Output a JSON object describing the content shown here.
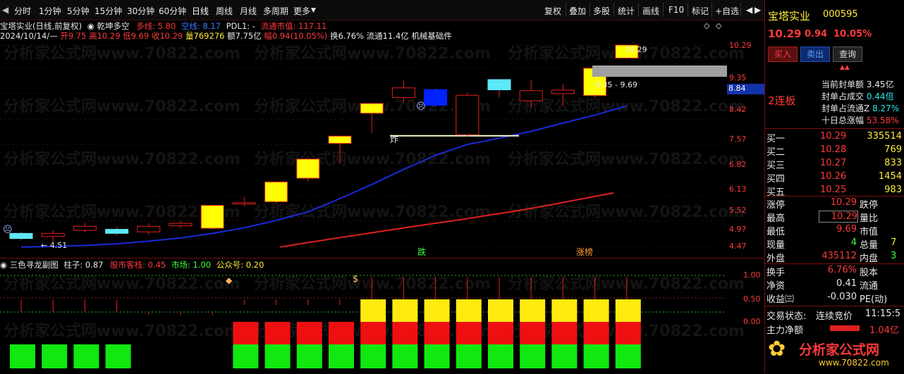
{
  "toolbar": {
    "left_items": [
      "分时",
      "1分钟",
      "5分钟",
      "15分钟",
      "30分钟",
      "60分钟",
      "日线",
      "周线",
      "月线",
      "多周期",
      "更多"
    ],
    "right_items": [
      "复权",
      "叠加",
      "多股",
      "统计",
      "画线",
      "F10",
      "标记",
      "+自选"
    ],
    "back_symbol": "◀"
  },
  "main_chart": {
    "title_line": {
      "name": "宝塔实业(日线,前复权)",
      "indicator_name": "乾坤多空",
      "duo_label": "多线: 5.80",
      "kong_label": "空线: 8.17",
      "pdl_label": "PDL1: -",
      "float_label": "流通市值: 117.11"
    },
    "quote_line": {
      "date": "2024/10/14/—",
      "open": "开9.75",
      "high": "高10.29",
      "low": "低9.69",
      "close": "收10.29",
      "volume": "量769276",
      "amount": "额7.75亿",
      "change": "幅0.94(10.05%)",
      "turnover": "换6.76%",
      "float_shares": "流通11.4亿",
      "sector": "机械基础件"
    },
    "price_labels": [
      "10.29",
      "9.35",
      "8.42",
      "7.57",
      "6.82",
      "6.13",
      "5.52",
      "4.97",
      "4.47"
    ],
    "current_tag": "8.84",
    "range_label": "9.35 - 9.69",
    "high_label": "10.29",
    "low_label": "← 4.51",
    "text_marks": {
      "zha": "炸",
      "die": "跌",
      "zhangting": "涨榜"
    },
    "watermark": "分析家公式网www.70822.com"
  },
  "sub_chart": {
    "name": "三色寻龙副图",
    "zhuzi": "柱子: 0.87",
    "guzhu": "股市客栈: 0.45",
    "shichang": "市场: 1.00",
    "gongzhonghao": "公众号: 0.20",
    "scale": [
      "1.00",
      "0.50",
      "0.00"
    ]
  },
  "chart_data": {
    "type": "candlestick",
    "candles": [
      {
        "open": 4.62,
        "close": 4.72,
        "high": 4.76,
        "low": 4.58,
        "color": "#5ee8f8"
      },
      {
        "open": 4.72,
        "close": 4.66,
        "high": 4.78,
        "low": 4.55,
        "color": "#000000"
      },
      {
        "open": 4.78,
        "close": 4.86,
        "high": 4.93,
        "low": 4.74,
        "color": "#000000"
      },
      {
        "open": 4.8,
        "close": 4.72,
        "high": 4.85,
        "low": 4.68,
        "color": "#5ee8f8"
      },
      {
        "open": 4.75,
        "close": 4.86,
        "high": 4.92,
        "low": 4.69,
        "color": "#000000"
      },
      {
        "open": 4.87,
        "close": 4.92,
        "high": 4.97,
        "low": 4.82,
        "color": "#000000"
      },
      {
        "open": 4.82,
        "close": 5.3,
        "high": 5.3,
        "low": 4.8,
        "color": "#ffff00"
      },
      {
        "open": 5.33,
        "close": 5.36,
        "high": 5.48,
        "low": 5.28,
        "color": "#000000"
      },
      {
        "open": 5.38,
        "close": 5.84,
        "high": 5.84,
        "low": 5.33,
        "color": "#ffff00"
      },
      {
        "open": 5.93,
        "close": 6.42,
        "high": 6.42,
        "low": 5.85,
        "color": "#ffff00"
      },
      {
        "open": 6.85,
        "close": 7.06,
        "high": 7.06,
        "low": 6.3,
        "color": "#ffff00"
      },
      {
        "open": 7.76,
        "close": 8.08,
        "high": 8.08,
        "low": 7.15,
        "color": "#ffff00"
      },
      {
        "open": 8.28,
        "close": 8.62,
        "high": 8.9,
        "low": 8.12,
        "color": "#000000"
      },
      {
        "open": 8.56,
        "close": 8.02,
        "high": 8.6,
        "low": 7.97,
        "color": "#0022ff"
      },
      {
        "open": 8.36,
        "close": 7.1,
        "high": 8.45,
        "low": 7.04,
        "color": "#000000"
      },
      {
        "open": 8.55,
        "close": 8.92,
        "high": 8.92,
        "low": 8.28,
        "color": "#5ee8f8"
      },
      {
        "open": 8.17,
        "close": 8.52,
        "high": 8.92,
        "low": 7.93,
        "color": "#000000"
      },
      {
        "open": 8.42,
        "close": 8.54,
        "high": 8.75,
        "low": 8.0,
        "color": "#000000"
      },
      {
        "open": 8.35,
        "close": 9.35,
        "high": 9.35,
        "low": 8.28,
        "color": "#ffff00"
      },
      {
        "open": 9.75,
        "close": 10.29,
        "high": 10.29,
        "low": 9.69,
        "color": "#ffff00"
      }
    ],
    "blue_line": [
      4.46,
      4.47,
      4.49,
      4.52,
      4.57,
      4.63,
      4.72,
      4.83,
      4.98,
      5.16,
      5.45,
      5.78,
      6.15,
      6.52,
      6.82,
      7.0,
      7.2,
      7.45,
      7.7,
      8.0
    ],
    "red_line": [
      4.46,
      4.55,
      4.64,
      4.73,
      4.82,
      4.91,
      5.0,
      5.1,
      5.2,
      5.32,
      5.45,
      5.58
    ],
    "sub_bars": {
      "green": [
        1,
        1,
        1,
        1,
        0,
        0,
        0,
        0,
        0,
        0,
        0,
        0,
        0,
        0,
        0,
        0,
        0,
        0,
        0,
        0
      ],
      "red": [
        0,
        0,
        0,
        0,
        0,
        0,
        0,
        1,
        1,
        1,
        1,
        1,
        1,
        1,
        1,
        1,
        1,
        1,
        1,
        1
      ],
      "yellow": [
        0,
        0,
        0,
        0,
        0,
        0,
        0,
        0,
        0,
        0,
        0,
        1,
        1,
        1,
        1,
        1,
        1,
        1,
        1,
        1
      ]
    }
  },
  "panel": {
    "stock_name": "宝塔实业",
    "stock_code": "000595",
    "price": "10.29",
    "change": "0.94",
    "change_pct": "10.05%",
    "buttons": [
      "买入",
      "卖出",
      "查询"
    ],
    "banner": "2连板",
    "seal": {
      "amount_label": "当前封单额",
      "amount_value": "3.45亿",
      "deal_label": "封单占成交",
      "deal_value": "0.44倍",
      "float_label": "封单占流通Z",
      "float_value": "8.27%",
      "ten_label": "十日总涨幅",
      "ten_value": "53.58%"
    },
    "bids": [
      {
        "label": "买一",
        "price": "10.29",
        "volume": "335514"
      },
      {
        "label": "买二",
        "price": "10.28",
        "volume": "769"
      },
      {
        "label": "买三",
        "price": "10.27",
        "volume": "833"
      },
      {
        "label": "买四",
        "price": "10.26",
        "volume": "1454"
      },
      {
        "label": "买五",
        "price": "10.25",
        "volume": "983"
      }
    ],
    "stats": [
      {
        "l": "涨停",
        "v": "10.29",
        "r": "跌停"
      },
      {
        "l": "最高",
        "v": "10.29",
        "r": "量比"
      },
      {
        "l": "最低",
        "v": "9.69",
        "r": "市值"
      },
      {
        "l": "现量",
        "v": "4",
        "r": "总量",
        "rv": "7"
      },
      {
        "l": "外盘",
        "v": "435112",
        "r": "内盘",
        "rv": "3"
      }
    ],
    "stats2": [
      {
        "l": "换手",
        "v": "6.76%",
        "r": "股本"
      },
      {
        "l": "净资",
        "v": "0.41",
        "r": "流通"
      },
      {
        "l": "收益㈢",
        "v": "-0.030",
        "r": "PE(动)"
      }
    ],
    "status_label": "交易状态:",
    "status_value": "连续竞价",
    "time": "11:15:5",
    "main_flow_label": "主力净额",
    "main_flow_value": "1.04亿",
    "logo_text": "分析家公式网",
    "logo_url": "www.70822.com"
  }
}
